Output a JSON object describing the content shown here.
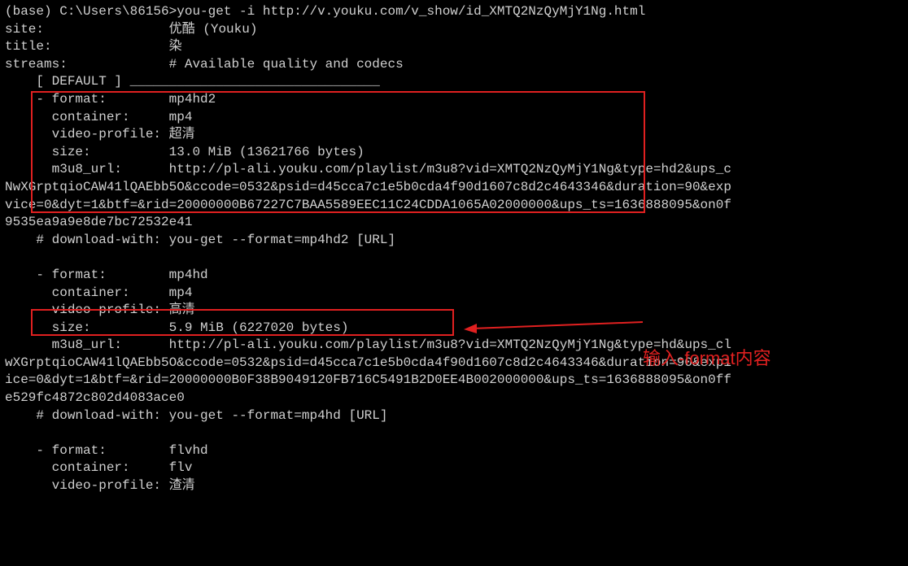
{
  "prompt": "(base) C:\\Users\\86156>you-get -i http://v.youku.com/v_show/id_XMTQ2NzQyMjY1Ng.html",
  "header": {
    "site_label": "site:",
    "site_value": "优酷 (Youku)",
    "title_label": "title:",
    "title_value": "染",
    "streams_label": "streams:",
    "streams_value": "# Available quality and codecs"
  },
  "default_marker": "    [ DEFAULT ] ________________________________",
  "stream1": {
    "format_label": "    - format:        ",
    "format_value": "mp4hd2",
    "container_label": "      container:     ",
    "container_value": "mp4",
    "profile_label": "      video-profile: ",
    "profile_value": "超清",
    "size_label": "      size:          ",
    "size_value": "13.0 MiB (13621766 bytes)",
    "m3u8_label": "      m3u8_url:      ",
    "m3u8_prefix": "http://pl-ali.youku.com/playlist/m3u8?vid=XMTQ2NzQyMjY1Ng&type=hd2&ups_c",
    "m3u8_l2": "NwXGrptqioCAW41lQAEbb5O&ccode=0532&psid=d45cca7c1e5b0cda4f90d1607c8d2c4643346&duration=90&exp",
    "m3u8_l3": "vice=0&dyt=1&btf=&rid=20000000B67227C7BAA5589EEC11C24CDDA1065A02000000&ups_ts=1636888095&on0f",
    "m3u8_l4": "9535ea9a9e8de7bc72532e41",
    "download_with": "    # download-with: you-get --format=mp4hd2 [URL]"
  },
  "stream2": {
    "format_label": "    - format:        ",
    "format_value": "mp4hd",
    "container_label": "      container:     ",
    "container_value": "mp4",
    "profile_label": "      video-profile: ",
    "profile_value": "高清",
    "size_label": "      size:          ",
    "size_value": "5.9 MiB (6227020 bytes)",
    "m3u8_label": "      m3u8_url:      ",
    "m3u8_prefix": "http://pl-ali.youku.com/playlist/m3u8?vid=XMTQ2NzQyMjY1Ng&type=hd&ups_cl",
    "m3u8_l2": "wXGrptqioCAW41lQAEbb5O&ccode=0532&psid=d45cca7c1e5b0cda4f90d1607c8d2c4643346&duration=90&expi",
    "m3u8_l3": "ice=0&dyt=1&btf=&rid=20000000B0F38B9049120FB716C5491B2D0EE4B002000000&ups_ts=1636888095&on0ff",
    "m3u8_l4": "e529fc4872c802d4083ace0",
    "download_with": "    # download-with: you-get --format=mp4hd [URL]"
  },
  "stream3": {
    "format_label": "    - format:        ",
    "format_value": "flvhd",
    "container_label": "      container:     ",
    "container_value": "flv",
    "profile_label": "      video-profile: ",
    "profile_value": "渣清"
  },
  "annotation": "输入-format内容"
}
